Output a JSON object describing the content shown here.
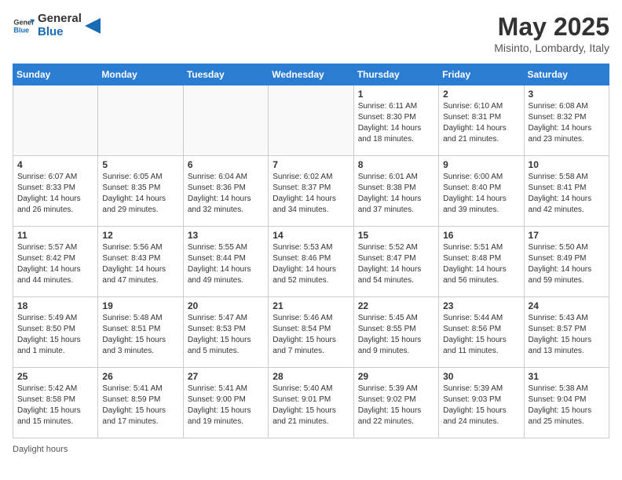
{
  "header": {
    "logo_general": "General",
    "logo_blue": "Blue",
    "title": "May 2025",
    "subtitle": "Misinto, Lombardy, Italy"
  },
  "columns": [
    "Sunday",
    "Monday",
    "Tuesday",
    "Wednesday",
    "Thursday",
    "Friday",
    "Saturday"
  ],
  "weeks": [
    [
      {
        "day": "",
        "info": ""
      },
      {
        "day": "",
        "info": ""
      },
      {
        "day": "",
        "info": ""
      },
      {
        "day": "",
        "info": ""
      },
      {
        "day": "1",
        "info": "Sunrise: 6:11 AM\nSunset: 8:30 PM\nDaylight: 14 hours and 18 minutes."
      },
      {
        "day": "2",
        "info": "Sunrise: 6:10 AM\nSunset: 8:31 PM\nDaylight: 14 hours and 21 minutes."
      },
      {
        "day": "3",
        "info": "Sunrise: 6:08 AM\nSunset: 8:32 PM\nDaylight: 14 hours and 23 minutes."
      }
    ],
    [
      {
        "day": "4",
        "info": "Sunrise: 6:07 AM\nSunset: 8:33 PM\nDaylight: 14 hours and 26 minutes."
      },
      {
        "day": "5",
        "info": "Sunrise: 6:05 AM\nSunset: 8:35 PM\nDaylight: 14 hours and 29 minutes."
      },
      {
        "day": "6",
        "info": "Sunrise: 6:04 AM\nSunset: 8:36 PM\nDaylight: 14 hours and 32 minutes."
      },
      {
        "day": "7",
        "info": "Sunrise: 6:02 AM\nSunset: 8:37 PM\nDaylight: 14 hours and 34 minutes."
      },
      {
        "day": "8",
        "info": "Sunrise: 6:01 AM\nSunset: 8:38 PM\nDaylight: 14 hours and 37 minutes."
      },
      {
        "day": "9",
        "info": "Sunrise: 6:00 AM\nSunset: 8:40 PM\nDaylight: 14 hours and 39 minutes."
      },
      {
        "day": "10",
        "info": "Sunrise: 5:58 AM\nSunset: 8:41 PM\nDaylight: 14 hours and 42 minutes."
      }
    ],
    [
      {
        "day": "11",
        "info": "Sunrise: 5:57 AM\nSunset: 8:42 PM\nDaylight: 14 hours and 44 minutes."
      },
      {
        "day": "12",
        "info": "Sunrise: 5:56 AM\nSunset: 8:43 PM\nDaylight: 14 hours and 47 minutes."
      },
      {
        "day": "13",
        "info": "Sunrise: 5:55 AM\nSunset: 8:44 PM\nDaylight: 14 hours and 49 minutes."
      },
      {
        "day": "14",
        "info": "Sunrise: 5:53 AM\nSunset: 8:46 PM\nDaylight: 14 hours and 52 minutes."
      },
      {
        "day": "15",
        "info": "Sunrise: 5:52 AM\nSunset: 8:47 PM\nDaylight: 14 hours and 54 minutes."
      },
      {
        "day": "16",
        "info": "Sunrise: 5:51 AM\nSunset: 8:48 PM\nDaylight: 14 hours and 56 minutes."
      },
      {
        "day": "17",
        "info": "Sunrise: 5:50 AM\nSunset: 8:49 PM\nDaylight: 14 hours and 59 minutes."
      }
    ],
    [
      {
        "day": "18",
        "info": "Sunrise: 5:49 AM\nSunset: 8:50 PM\nDaylight: 15 hours and 1 minute."
      },
      {
        "day": "19",
        "info": "Sunrise: 5:48 AM\nSunset: 8:51 PM\nDaylight: 15 hours and 3 minutes."
      },
      {
        "day": "20",
        "info": "Sunrise: 5:47 AM\nSunset: 8:53 PM\nDaylight: 15 hours and 5 minutes."
      },
      {
        "day": "21",
        "info": "Sunrise: 5:46 AM\nSunset: 8:54 PM\nDaylight: 15 hours and 7 minutes."
      },
      {
        "day": "22",
        "info": "Sunrise: 5:45 AM\nSunset: 8:55 PM\nDaylight: 15 hours and 9 minutes."
      },
      {
        "day": "23",
        "info": "Sunrise: 5:44 AM\nSunset: 8:56 PM\nDaylight: 15 hours and 11 minutes."
      },
      {
        "day": "24",
        "info": "Sunrise: 5:43 AM\nSunset: 8:57 PM\nDaylight: 15 hours and 13 minutes."
      }
    ],
    [
      {
        "day": "25",
        "info": "Sunrise: 5:42 AM\nSunset: 8:58 PM\nDaylight: 15 hours and 15 minutes."
      },
      {
        "day": "26",
        "info": "Sunrise: 5:41 AM\nSunset: 8:59 PM\nDaylight: 15 hours and 17 minutes."
      },
      {
        "day": "27",
        "info": "Sunrise: 5:41 AM\nSunset: 9:00 PM\nDaylight: 15 hours and 19 minutes."
      },
      {
        "day": "28",
        "info": "Sunrise: 5:40 AM\nSunset: 9:01 PM\nDaylight: 15 hours and 21 minutes."
      },
      {
        "day": "29",
        "info": "Sunrise: 5:39 AM\nSunset: 9:02 PM\nDaylight: 15 hours and 22 minutes."
      },
      {
        "day": "30",
        "info": "Sunrise: 5:39 AM\nSunset: 9:03 PM\nDaylight: 15 hours and 24 minutes."
      },
      {
        "day": "31",
        "info": "Sunrise: 5:38 AM\nSunset: 9:04 PM\nDaylight: 15 hours and 25 minutes."
      }
    ]
  ],
  "footer": "Daylight hours"
}
